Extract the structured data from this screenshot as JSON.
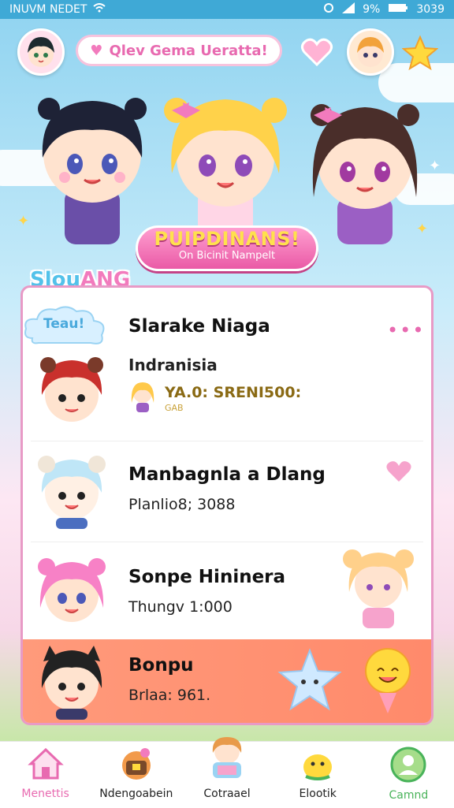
{
  "status_bar": {
    "carrier": "INUVM NEDET",
    "battery_percent": "9%",
    "time": "3039"
  },
  "header": {
    "title": "Qlev Gema Ueratta!",
    "accent_color": "#e86ab0"
  },
  "event_badge": {
    "title": "PUIPDINANS!",
    "subtitle": "On Bicinit Nampelt"
  },
  "section": {
    "label_part1": "Slou",
    "label_part2": "ANG"
  },
  "list": [
    {
      "tag": "Teau!",
      "name": "Slarake Niaga",
      "subtitle": "Indranisia",
      "reward_text": "YA.0: SRENI500:",
      "reward_small": "GAB",
      "icon": "red-hair-bear-avatar"
    },
    {
      "name": "Manbagnla a Dlang",
      "subtitle": "Planlio8; 3088",
      "icon": "blue-hair-bear-avatar"
    },
    {
      "name": "Sonpe Hininera",
      "subtitle": "Thungv 1:000",
      "icon": "pink-hair-bear-avatar"
    },
    {
      "name": "Bonpu",
      "subtitle": "Brlaa: 961.",
      "icon": "dark-hair-cat-avatar"
    }
  ],
  "tabs": [
    {
      "label": "Menettis",
      "icon": "home-icon"
    },
    {
      "label": "Ndengoabein",
      "icon": "chest-icon"
    },
    {
      "label": "Cotraael",
      "icon": "character-icon"
    },
    {
      "label": "Elootik",
      "icon": "creature-icon"
    },
    {
      "label": "Camnd",
      "icon": "profile-icon"
    }
  ]
}
